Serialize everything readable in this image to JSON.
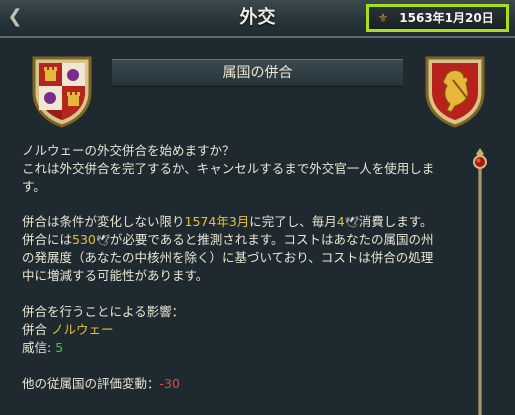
{
  "window": {
    "title": "外交",
    "date": "1563年1月20日"
  },
  "dialog": {
    "subtitle": "属国の併合"
  },
  "body": {
    "line1": "ノルウェーの外交併合を始めますか？",
    "line2": "これは外交併合を完了するか、キャンセルするまで外交官一人を使用しま",
    "line3": "す。",
    "line4a": "併合は条件が変化しない限り",
    "line4_date": "1574年3月",
    "line4b": "に完了し、毎月",
    "line4_cost": "4",
    "line4c": "消費します。",
    "line5a": "併合には",
    "line5_total": "530",
    "line5b": "が必要であると推測されます。コストはあなたの属国の州",
    "line6": "の発展度（あなたの中核州を除く）に基づいており、コストは併合の処理",
    "line7": "中に増減する可能性があります。",
    "effects_header": "併合を行うことによる影響：",
    "annex_label": "併合",
    "annex_target": "ノルウェー",
    "prestige_label": "威信:",
    "prestige_value": "5",
    "subject_label": "他の従属国の評価変動：",
    "subject_value": "-30"
  },
  "colors": {
    "highlight": "#e9c02c",
    "positive": "#4fc43a",
    "negative": "#e04a3c",
    "date_border": "#a6e01c"
  },
  "icons": {
    "close": "close-icon",
    "date": "date-emblem-icon",
    "currency": "dove-icon"
  }
}
